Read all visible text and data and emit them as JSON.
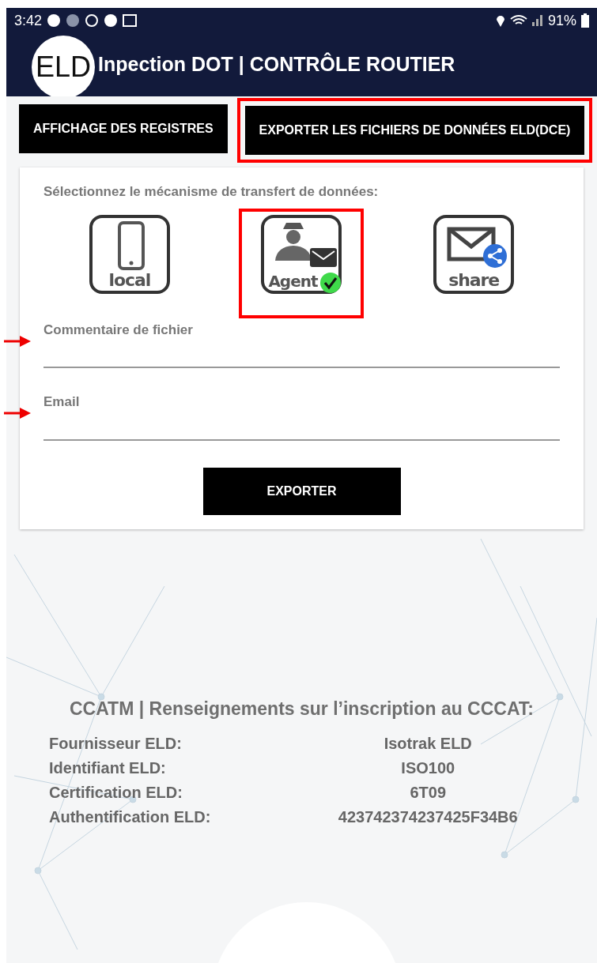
{
  "status_bar": {
    "time": "3:42",
    "battery": "91%"
  },
  "header": {
    "logo": "ELD",
    "title": "Inpection DOT | CONTRÔLE ROUTIER"
  },
  "tabs": [
    {
      "label": "AFFICHAGE DES REGISTRES",
      "selected": false
    },
    {
      "label": "EXPORTER LES FICHIERS DE DONNÉES ELD(DCE)",
      "selected": true
    }
  ],
  "transfer": {
    "prompt": "Sélectionnez le mécanisme de transfert de données:",
    "options": [
      {
        "kind": "local",
        "label": "local",
        "selected": false
      },
      {
        "kind": "agent",
        "label": "Agent",
        "selected": true
      },
      {
        "kind": "share",
        "label": "share",
        "selected": false
      }
    ]
  },
  "fields": [
    {
      "label": "Commentaire de fichier"
    },
    {
      "label": "Email"
    }
  ],
  "export_button": "EXPORTER",
  "registration": {
    "title": "CCATM | Renseignements sur l’inscription au CCCAT:",
    "rows": [
      {
        "label": "Fournisseur ELD:",
        "value": "Isotrak ELD"
      },
      {
        "label": "Identifiant ELD:",
        "value": "ISO100"
      },
      {
        "label": "Certification ELD:",
        "value": "6T09"
      },
      {
        "label": "Authentification ELD:",
        "value": "423742374237425F34B6"
      }
    ]
  }
}
